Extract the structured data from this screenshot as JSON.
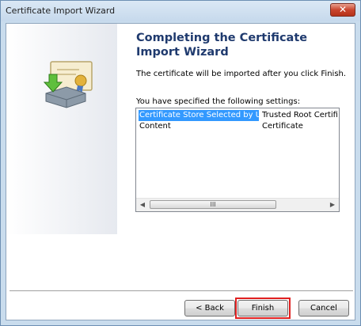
{
  "window": {
    "title": "Certificate Import Wizard",
    "close_label": "✕"
  },
  "page": {
    "heading": "Completing the Certificate Import Wizard",
    "description": "The certificate will be imported after you click Finish.",
    "settings_label": "You have specified the following settings:"
  },
  "settings": [
    {
      "name": "Certificate Store Selected by User",
      "value": "Trusted Root Certificat",
      "selected": true
    },
    {
      "name": "Content",
      "value": "Certificate",
      "selected": false
    }
  ],
  "scrollbar": {
    "left_arrow": "◀",
    "right_arrow": "▶",
    "thumb_grip": "III"
  },
  "buttons": {
    "back": "< Back",
    "finish": "Finish",
    "cancel": "Cancel"
  },
  "annotation": {
    "highlight_color": "#e02020",
    "highlighted_control": "finish-button"
  }
}
